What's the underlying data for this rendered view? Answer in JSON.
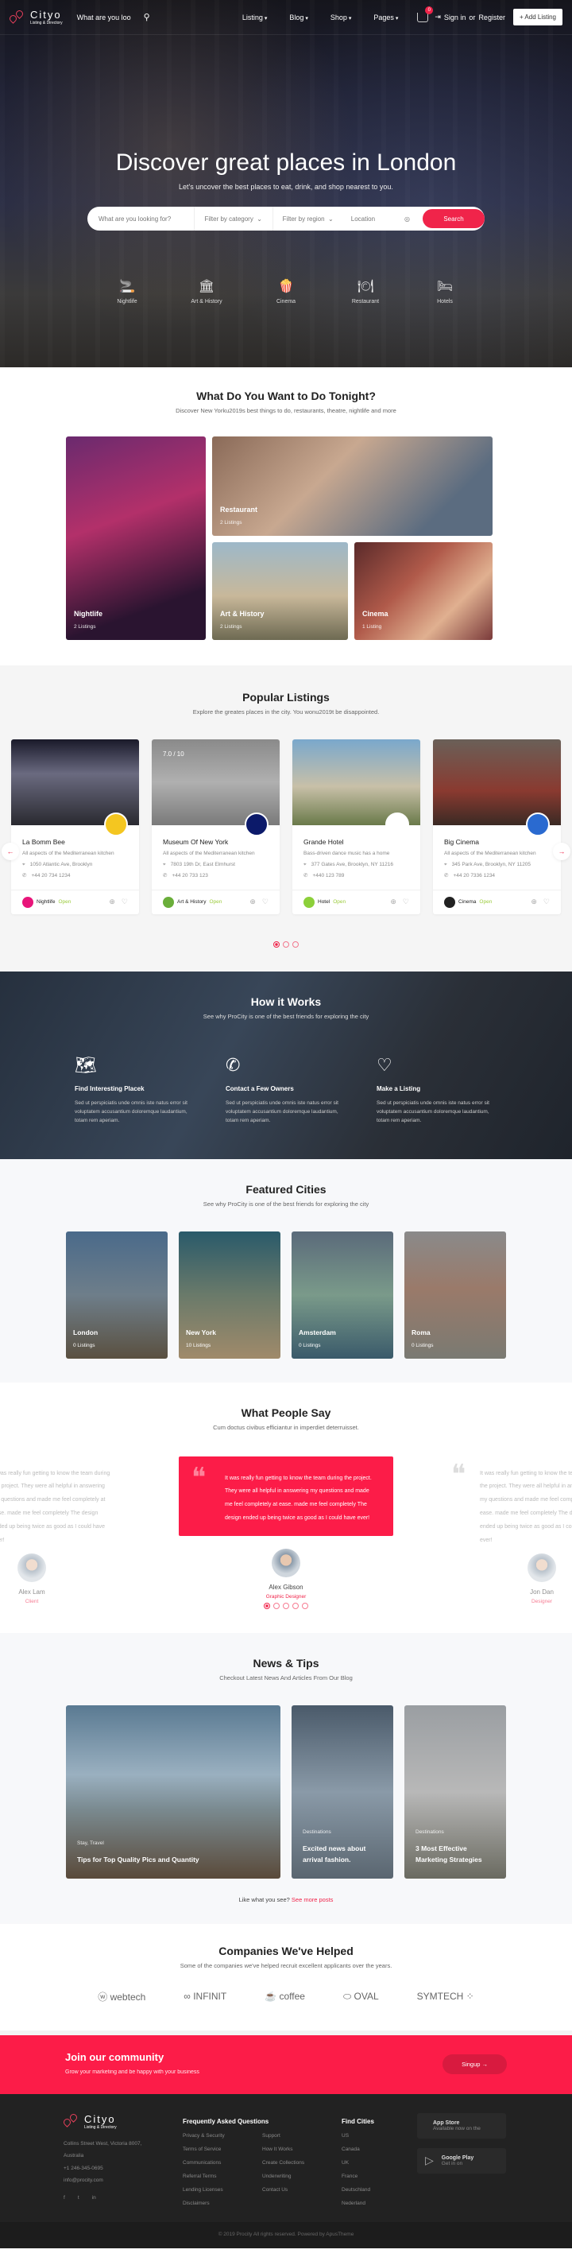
{
  "nav": {
    "logo_name": "Cityo",
    "logo_tagline": "Listing & Directory",
    "search_placeholder": "What are you loo",
    "menu": [
      "Listing",
      "Blog",
      "Shop",
      "Pages"
    ],
    "cart_count": "0",
    "sign_in": "Sign in",
    "or": "or",
    "register": "Register",
    "add_listing": "+ Add Listing"
  },
  "hero": {
    "title": "Discover great places in London",
    "subtitle": "Let's uncover the best places to eat, drink, and shop nearest to you.",
    "search": {
      "keyword_placeholder": "What are you looking for?",
      "category": "Filter by category",
      "region": "Filter by region",
      "location_placeholder": "Location",
      "button": "Search"
    },
    "categories": [
      {
        "icon": "cigarette-icon",
        "glyph": "🚬",
        "label": "Nightlife"
      },
      {
        "icon": "museum-icon",
        "glyph": "🏛",
        "label": "Art & History"
      },
      {
        "icon": "popcorn-icon",
        "glyph": "🍿",
        "label": "Cinema"
      },
      {
        "icon": "dinner-plate-icon",
        "glyph": "🍽",
        "label": "Restaurant"
      },
      {
        "icon": "bed-icon",
        "glyph": "🛏",
        "label": "Hotels"
      }
    ]
  },
  "tonight": {
    "title": "What Do You Want to Do Tonight?",
    "subtitle": "Discover New Yorku2019s best things to do, restaurants, theatre, nightlife and more",
    "tiles": [
      {
        "name": "Nightlife",
        "count": "2 Listings"
      },
      {
        "name": "Restaurant",
        "count": "2 Listings"
      },
      {
        "name": "Art & History",
        "count": "2 Listings"
      },
      {
        "name": "Cinema",
        "count": "1 Listing"
      }
    ]
  },
  "popular": {
    "title": "Popular Listings",
    "subtitle": "Explore the greates places in the city. You wonu2019t be disappointed.",
    "listings": [
      {
        "name": "La Bomm Bee",
        "desc": "All aspects of the Mediterranean kitchen",
        "address": "1050 Atlantic Ave, Brooklyn",
        "phone": "+44 20 734 1234",
        "category": "Nightlife",
        "status": "Open",
        "rating": ""
      },
      {
        "name": "Museum Of New York",
        "desc": "All aspects of the Mediterranean kitchen",
        "address": "7803 19th Dr, East Elmhurst",
        "phone": "+44 20 733 123",
        "category": "Art & History",
        "status": "Open",
        "rating": "7.0 / 10"
      },
      {
        "name": "Grande Hotel",
        "desc": "Bass-driven dance music has a home",
        "address": "377 Gates Ave, Brooklyn, NY 11216",
        "phone": "+440 123 789",
        "category": "Hotel",
        "status": "Open",
        "rating": ""
      },
      {
        "name": "Big Cinema",
        "desc": "All aspects of the Mediterranean kitchen",
        "address": "345 Park Ave, Brooklyn, NY 11205",
        "phone": "+44 20 7336 1234",
        "category": "Cinema",
        "status": "Open",
        "rating": ""
      }
    ],
    "active_page": 1,
    "page_count": 3
  },
  "how": {
    "title": "How it Works",
    "subtitle": "See why ProCity is one of the best friends for exploring the city",
    "steps": [
      {
        "title": "Find Interesting Placek",
        "text": "Sed ut perspiciatis unde omnis iste natus error sit voluptatem accusantium doloremque laudantium, totam rem aperiam."
      },
      {
        "title": "Contact a Few Owners",
        "text": "Sed ut perspiciatis unde omnis iste natus error sit voluptatem accusantium doloremque laudantium, totam rem aperiam."
      },
      {
        "title": "Make a Listing",
        "text": "Sed ut perspiciatis unde omnis iste natus error sit voluptatem accusantium doloremque laudantium, totam rem aperiam."
      }
    ]
  },
  "cities": {
    "title": "Featured Cities",
    "subtitle": "See why ProCity is one of the best friends for exploring the city",
    "items": [
      {
        "name": "London",
        "count": "0 Listings"
      },
      {
        "name": "New York",
        "count": "10 Listings"
      },
      {
        "name": "Amsterdam",
        "count": "0 Listings"
      },
      {
        "name": "Roma",
        "count": "0 Listings"
      }
    ]
  },
  "testimonials": {
    "title": "What People Say",
    "subtitle": "Cum doctus civibus efficiantur in imperdiet deterruisset.",
    "quote": "It was really fun getting to know the team during the project. They were all helpful in answering my questions and made me feel completely at ease. made me feel completely The design ended up being twice as good as I could have ever!",
    "people": [
      {
        "name": "Alex Lam",
        "role": "Client"
      },
      {
        "name": "Alex Gibson",
        "role": "Graphic Designer"
      },
      {
        "name": "Jon Dan",
        "role": "Designer"
      }
    ],
    "active_page": 1,
    "page_count": 5
  },
  "news": {
    "title": "News & Tips",
    "subtitle": "Checkout Latest News And Articles From Our Blog",
    "posts": [
      {
        "tag": "Stay, Travel",
        "title": "Tips for Top Quality Pics and Quantity"
      },
      {
        "tag": "Destinations",
        "title": "Excited news about arrival fashion."
      },
      {
        "tag": "Destinations",
        "title": "3 Most Effective Marketing Strategies"
      }
    ],
    "more_prefix": "Like what you see?",
    "more_link": "See more posts"
  },
  "companies": {
    "title": "Companies We've Helped",
    "subtitle": "Some of the companies we've helped recruit excellent applicants over the years.",
    "logos": [
      "webtech",
      "INFINIT",
      "coffee",
      "OVAL",
      "SYMTECH"
    ]
  },
  "join": {
    "title": "Join our community",
    "subtitle": "Grow your marketing and be happy with your business",
    "button": "Singup →"
  },
  "footer": {
    "logo_name": "Cityo",
    "logo_tagline": "Listing & Directory",
    "address1": "Collins Street West, Victoria 8007,",
    "address2": "Australia",
    "phone": "+1 246-345-0695",
    "email": "info@procity.com",
    "faq_title": "Frequently Asked Questions",
    "faq_links": [
      "Privacy & Security",
      "Support",
      "Terms of Service",
      "How It Works",
      "Communications",
      "Create Collections",
      "Referral Terms",
      "Underwriting",
      "Lending Licenses",
      "Contact Us",
      "Disclaimers"
    ],
    "cities_title": "Find Cities",
    "city_links": [
      "US",
      "Canada",
      "UK",
      "France",
      "Deutschland",
      "Nederland"
    ],
    "stores": [
      {
        "name": "App Store",
        "sub": "Available now on the"
      },
      {
        "name": "Google Play",
        "sub": "Get in on"
      }
    ],
    "copyright": "© 2019 Procity All rights reserved. Powered by ApusTheme"
  }
}
